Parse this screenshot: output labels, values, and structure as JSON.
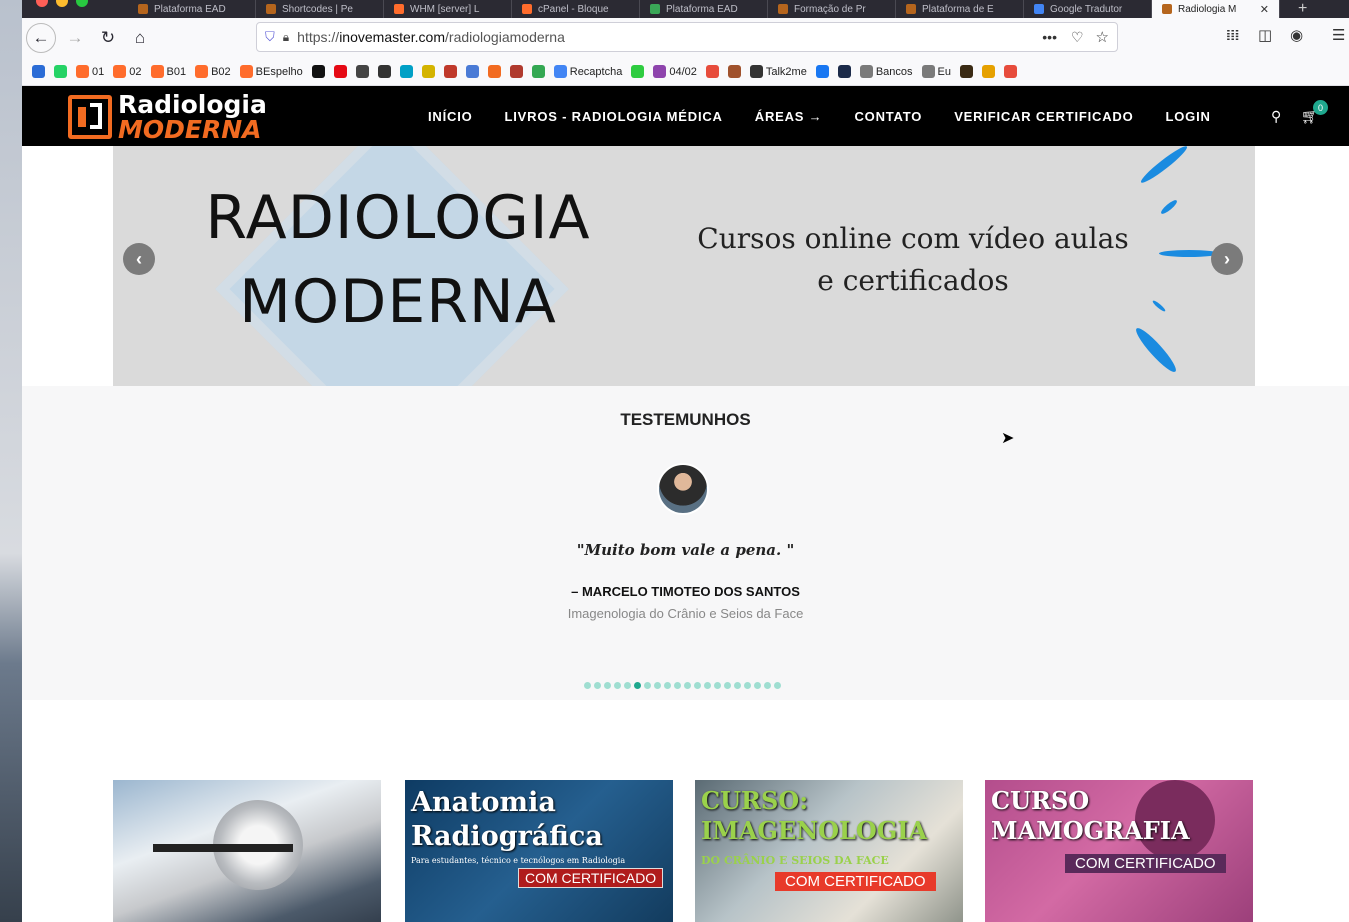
{
  "browser": {
    "tabs": [
      {
        "label": "Plataforma EAD",
        "fav": "#b5651d"
      },
      {
        "label": "Shortcodes | Pe",
        "fav": "#b5651d"
      },
      {
        "label": "WHM [server] L",
        "fav": "#ff6c2c"
      },
      {
        "label": "cPanel - Bloque",
        "fav": "#ff6c2c"
      },
      {
        "label": "Plataforma EAD",
        "fav": "#3aa757"
      },
      {
        "label": "Formação de Pr",
        "fav": "#b5651d"
      },
      {
        "label": "Plataforma de E",
        "fav": "#b5651d"
      },
      {
        "label": "Google Tradutor",
        "fav": "#4285f4"
      },
      {
        "label": "Radiologia M",
        "fav": "#b5651d"
      }
    ],
    "url_prefix": "https://",
    "url_host": "inovemaster.com",
    "url_path": "/radiologiamoderna",
    "bookmarks": [
      {
        "label": "",
        "color": "#2b6cd6"
      },
      {
        "label": "",
        "color": "#25d366"
      },
      {
        "label": "01",
        "color": "#ff6c2c"
      },
      {
        "label": "02",
        "color": "#ff6c2c"
      },
      {
        "label": "B01",
        "color": "#ff6c2c"
      },
      {
        "label": "B02",
        "color": "#ff6c2c"
      },
      {
        "label": "BEspelho",
        "color": "#ff6c2c"
      },
      {
        "label": "",
        "color": "#111111"
      },
      {
        "label": "",
        "color": "#e50914"
      },
      {
        "label": "",
        "color": "#444444"
      },
      {
        "label": "",
        "color": "#333333"
      },
      {
        "label": "",
        "color": "#00a0c6"
      },
      {
        "label": "",
        "color": "#d4b400"
      },
      {
        "label": "",
        "color": "#c0392b"
      },
      {
        "label": "",
        "color": "#4a7bd6"
      },
      {
        "label": "",
        "color": "#f26b21"
      },
      {
        "label": "",
        "color": "#b03a2e"
      },
      {
        "label": "",
        "color": "#34a853"
      },
      {
        "label": "Recaptcha",
        "color": "#4285f4"
      },
      {
        "label": "",
        "color": "#2ecc40"
      },
      {
        "label": "04/02",
        "color": "#8e44ad"
      },
      {
        "label": "",
        "color": "#e74c3c"
      },
      {
        "label": "",
        "color": "#a0522d"
      },
      {
        "label": "Talk2me",
        "color": "#333333"
      },
      {
        "label": "",
        "color": "#1877f2"
      },
      {
        "label": "",
        "color": "#1c2b4a"
      },
      {
        "label": "Bancos",
        "color": "#7a7a7a"
      },
      {
        "label": "Eu",
        "color": "#7a7a7a"
      },
      {
        "label": "",
        "color": "#3a2a14"
      },
      {
        "label": "",
        "color": "#e6a100"
      },
      {
        "label": "",
        "color": "#e74c3c"
      }
    ]
  },
  "site": {
    "logo_line1": "Radiologia",
    "logo_line2": "MODERNA",
    "menu": [
      "INÍCIO",
      "LIVROS - RADIOLOGIA MÉDICA",
      "ÁREAS →",
      "CONTATO",
      "VERIFICAR CERTIFICADO",
      "LOGIN"
    ],
    "cart_count": "0",
    "colors": {
      "accent": "#f26b21",
      "teal": "#1fa88e",
      "header": "#000000"
    }
  },
  "hero": {
    "title_line1": "RADIOLOGIA",
    "title_line2": "MODERNA",
    "subtitle_line1": "Cursos online com vídeo aulas",
    "subtitle_line2": "e certificados"
  },
  "testimonials": {
    "title": "TESTEMUNHOS",
    "quote": "\"Muito bom vale a pena.  \"",
    "author": "– MARCELO TIMOTEO DOS SANTOS",
    "role": "Imagenologia do Crânio e Seios da Face",
    "dot_count": 20,
    "active_dot": 5
  },
  "courses": [
    {
      "title_l1": "",
      "title_l2": "",
      "small": "",
      "cert": ""
    },
    {
      "title_l1": "Anatomia",
      "title_l2": "Radiográfica",
      "small": "Para estudantes, técnico e tecnólogos em Radiologia",
      "cert": "COM CERTIFICADO"
    },
    {
      "title_l1": "CURSO:",
      "title_l2": "IMAGENOLOGIA",
      "small": "DO CRÂNIO E SEIOS DA FACE",
      "cert": "COM CERTIFICADO"
    },
    {
      "title_l1": "CURSO",
      "title_l2": "MAMOGRAFIA",
      "small": "",
      "cert": "COM CERTIFICADO"
    }
  ]
}
